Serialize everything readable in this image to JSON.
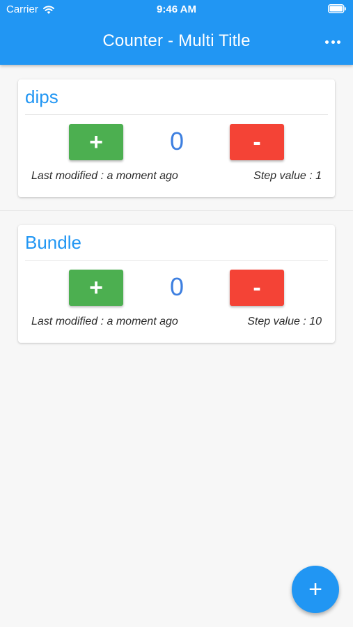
{
  "status_bar": {
    "carrier": "Carrier",
    "time": "9:46 AM"
  },
  "appbar": {
    "title": "Counter - Multi Title",
    "menu_icon": "more-horiz-icon",
    "color": "#2196f3"
  },
  "counters": [
    {
      "title": "dips",
      "count": "0",
      "plus_label": "+",
      "minus_label": "-",
      "last_modified": "Last modified : a moment ago",
      "step_value": "Step value : 1"
    },
    {
      "title": "Bundle",
      "count": "0",
      "plus_label": "+",
      "minus_label": "-",
      "last_modified": "Last modified : a moment ago",
      "step_value": "Step value : 10"
    }
  ],
  "fab": {
    "label": "+",
    "icon": "add-icon"
  },
  "colors": {
    "accent": "#2196f3",
    "plus": "#4caf50",
    "minus": "#f44336",
    "count": "#3d7fe0"
  }
}
